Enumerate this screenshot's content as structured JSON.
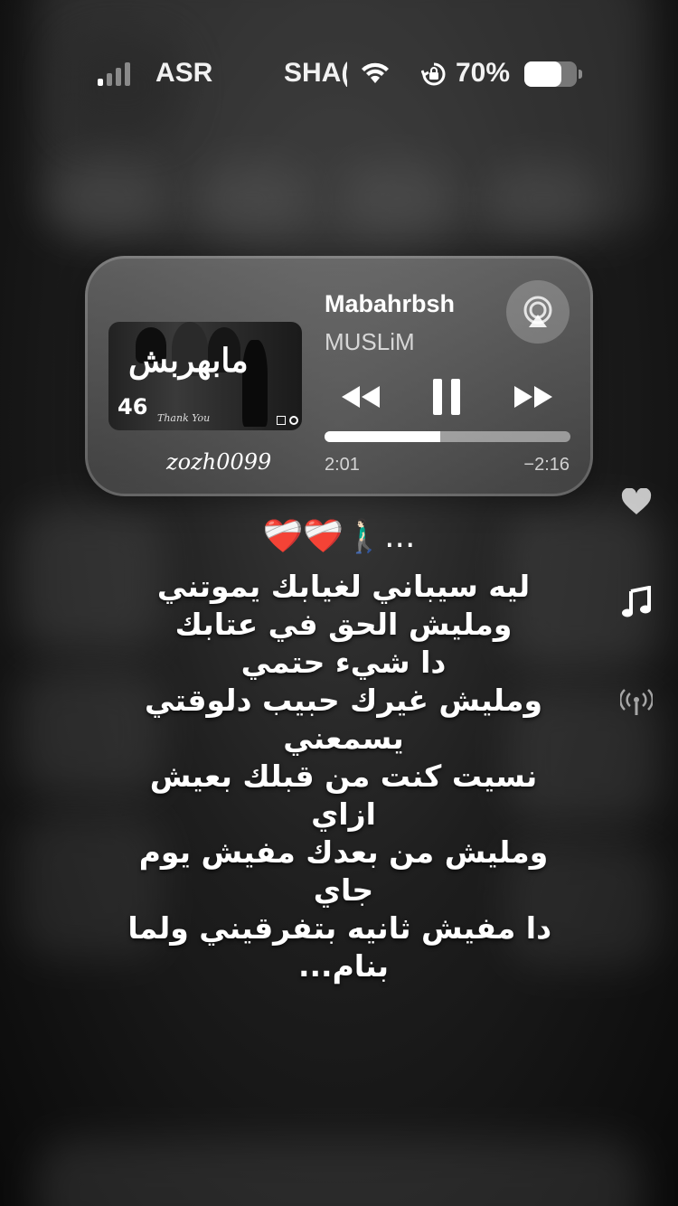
{
  "status_bar": {
    "carrier": "ASR",
    "wifi_name": "SHA(",
    "battery_percent": "70%",
    "battery_level": 0.7,
    "signal_bars_on": 1,
    "signal_bars_total": 4
  },
  "player": {
    "title": "Mabahrbsh",
    "artist": "MUSLiM",
    "elapsed": "2:01",
    "remaining": "−2:16",
    "progress": 0.47,
    "artwork": {
      "title": "مابهربش",
      "number": "46",
      "caption": "Thank You"
    },
    "watermark": "zozh0099",
    "icons": {
      "airplay": "airplay-icon",
      "rewind": "rewind-icon",
      "pause": "pause-icon",
      "forward": "fast-forward-icon"
    }
  },
  "side_actions": {
    "icons": [
      "heart-icon",
      "music-note-icon",
      "broadcast-icon"
    ]
  },
  "caption": {
    "lead": "❤️‍🩹❤️‍🩹🚶🏻‍♂️...",
    "lines": [
      "ليه سيباني لغيابك يموتني",
      "ومليش الحق في عتابك",
      "دا شيء حتمي",
      "ومليش غيرك حبيب دلوقتي",
      "يسمعني",
      "نسيت كنت من قبلك بعيش",
      "ازاي",
      "ومليش من بعدك مفيش يوم",
      "جاي",
      "دا مفيش ثانيه بتفرقيني ولما",
      "بنام..."
    ]
  }
}
